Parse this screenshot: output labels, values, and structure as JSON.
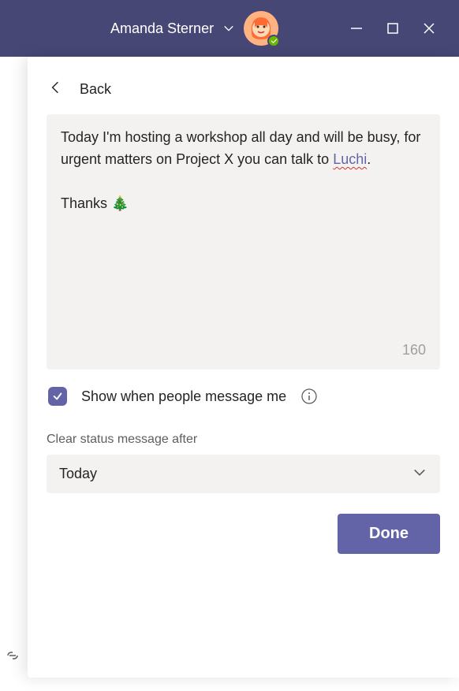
{
  "titleBar": {
    "userName": "Amanda Sterner"
  },
  "panel": {
    "backLabel": "Back",
    "status": {
      "textBefore": "Today I'm hosting a workshop all day and will be busy, for urgent matters on Project X you can talk to ",
      "mention": "Luchi",
      "textAfter": ".",
      "closing": "Thanks 🎄",
      "charCount": "160"
    },
    "checkbox": {
      "checked": true,
      "label": "Show when people message me"
    },
    "clearAfter": {
      "label": "Clear status message after",
      "value": "Today"
    },
    "doneLabel": "Done"
  }
}
